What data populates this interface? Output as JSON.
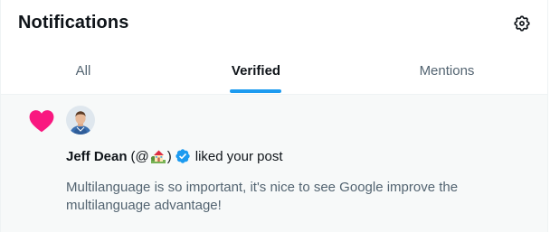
{
  "header": {
    "title": "Notifications",
    "settings_icon": "gear-icon"
  },
  "tabs": [
    {
      "label": "All",
      "active": false
    },
    {
      "label": "Verified",
      "active": true
    },
    {
      "label": "Mentions",
      "active": false
    }
  ],
  "notification": {
    "type_icon": "heart-icon",
    "actor": {
      "name": "Jeff Dean",
      "handle_open": "(@",
      "handle_emoji": "house-with-garden-emoji",
      "handle_close": ")",
      "verified_icon": "verified-badge-icon"
    },
    "action": "liked your post",
    "post_preview": "Multilanguage is so important, it's nice to see Google improve the multilanguage advantage!"
  },
  "colors": {
    "accent": "#1d9bf0",
    "heart": "#f91880",
    "text_primary": "#0f1419",
    "text_secondary": "#536471",
    "highlight_bg": "#f7f9f9"
  }
}
